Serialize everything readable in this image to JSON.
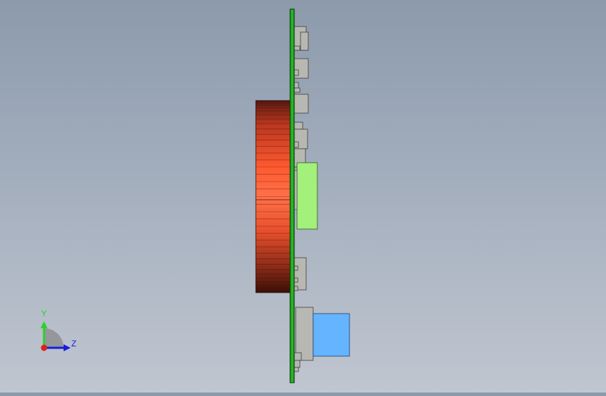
{
  "triad": {
    "y_label": "Y",
    "z_label": "Z",
    "y_color": "#27d327",
    "z_color": "#1a1ae0",
    "x_color": "#e02020"
  },
  "colors": {
    "pcb": "#1e9e1e",
    "pcb_edge": "#0a4d0a",
    "connector_gray": "#b5b5b0",
    "green_component": "#a3f07a",
    "blue_component": "#64b4ff",
    "fan_light": "#ff6a3a",
    "fan_dark": "#5a1a10"
  }
}
